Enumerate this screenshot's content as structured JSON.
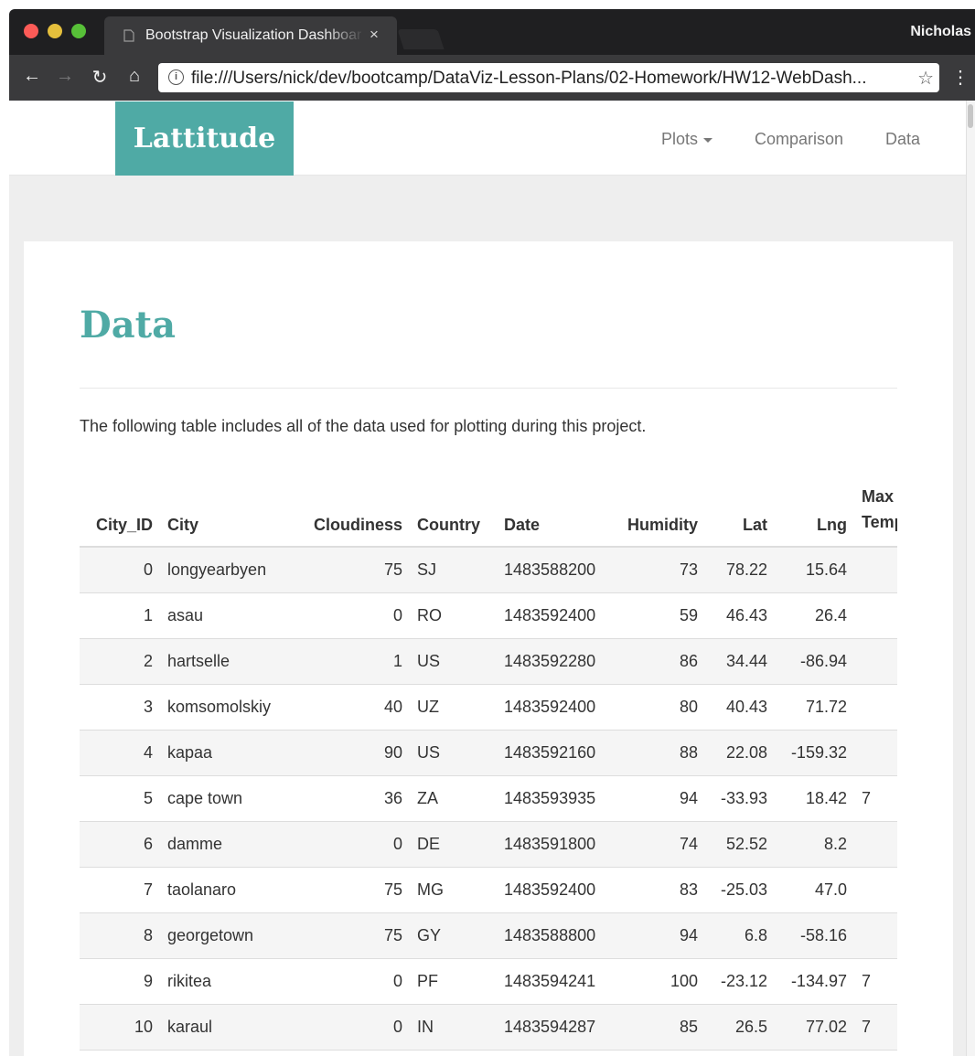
{
  "browser": {
    "tab_title": "Bootstrap Visualization Dashboard",
    "tab_close": "×",
    "user": "Nicholas",
    "url": "file:///Users/nick/dev/bootcamp/DataViz-Lesson-Plans/02-Homework/HW12-WebDash...",
    "back": "←",
    "forward": "→",
    "reload": "↻",
    "home": "⌂",
    "star": "☆",
    "menu": "⋮",
    "info": "i"
  },
  "navbar": {
    "brand": "Lattitude",
    "links": [
      {
        "label": "Plots",
        "dropdown": true
      },
      {
        "label": "Comparison"
      },
      {
        "label": "Data"
      }
    ]
  },
  "page": {
    "heading": "Data",
    "intro": "The following table includes all of the data used for plotting during this project."
  },
  "table": {
    "headers": [
      "City_ID",
      "City",
      "Cloudiness",
      "Country",
      "Date",
      "Humidity",
      "Lat",
      "Lng",
      "Max Temp"
    ],
    "rows": [
      [
        "0",
        "longyearbyen",
        "75",
        "SJ",
        "1483588200",
        "73",
        "78.22",
        "15.64",
        ""
      ],
      [
        "1",
        "asau",
        "0",
        "RO",
        "1483592400",
        "59",
        "46.43",
        "26.4",
        ""
      ],
      [
        "2",
        "hartselle",
        "1",
        "US",
        "1483592280",
        "86",
        "34.44",
        "-86.94",
        ""
      ],
      [
        "3",
        "komsomolskiy",
        "40",
        "UZ",
        "1483592400",
        "80",
        "40.43",
        "71.72",
        ""
      ],
      [
        "4",
        "kapaa",
        "90",
        "US",
        "1483592160",
        "88",
        "22.08",
        "-159.32",
        ""
      ],
      [
        "5",
        "cape town",
        "36",
        "ZA",
        "1483593935",
        "94",
        "-33.93",
        "18.42",
        "7"
      ],
      [
        "6",
        "damme",
        "0",
        "DE",
        "1483591800",
        "74",
        "52.52",
        "8.2",
        ""
      ],
      [
        "7",
        "taolanaro",
        "75",
        "MG",
        "1483592400",
        "83",
        "-25.03",
        "47.0",
        ""
      ],
      [
        "8",
        "georgetown",
        "75",
        "GY",
        "1483588800",
        "94",
        "6.8",
        "-58.16",
        ""
      ],
      [
        "9",
        "rikitea",
        "0",
        "PF",
        "1483594241",
        "100",
        "-23.12",
        "-134.97",
        "7"
      ],
      [
        "10",
        "karaul",
        "0",
        "IN",
        "1483594287",
        "85",
        "26.5",
        "77.02",
        "7"
      ]
    ]
  },
  "colors": {
    "brand": "#4faaa5",
    "chrome": "#3a3a3c"
  }
}
